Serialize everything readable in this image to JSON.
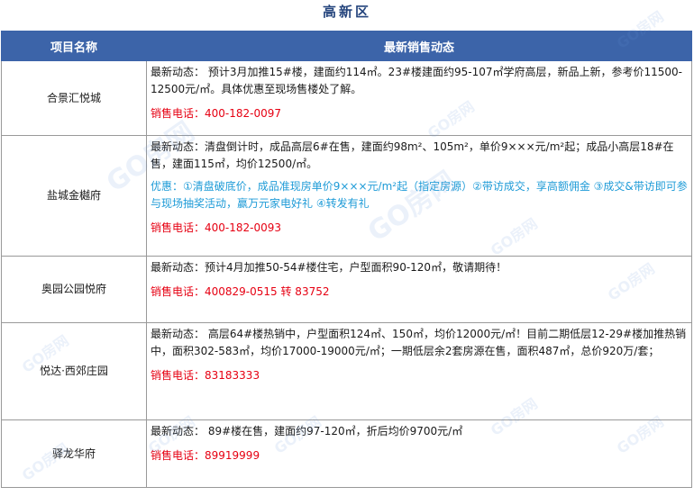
{
  "title": "高新区",
  "headers": {
    "name": "项目名称",
    "news": "最新销售动态"
  },
  "projects": [
    {
      "name": "合景汇悦城",
      "news": "最新动态： 预计3月加推15#楼，建面约114㎡。23#楼建面约95-107㎡学府高层，新品上新，参考价11500-12500元/㎡。具体优惠至现场售楼处了解。",
      "promo": "",
      "phone": "销售电话：400-182-0097"
    },
    {
      "name": "盐城金樾府",
      "news": "最新动态：清盘倒计时，成品高层6#在售，建面约98m²、105m²，单价9×××元/m²起；成品小高层18#在售，建面115㎡，均价12500/㎡。",
      "promo": "优惠：①清盘破底价，成品准现房单价9×××元/m²起（指定房源）②带访成交，享高额佣金 ③成交&带访即可参与现场抽奖活动，赢万元家电好礼 ④转发有礼",
      "phone": "销售电话：400-182-0093"
    },
    {
      "name": "奥园公园悦府",
      "news": "最新动态：预计4月加推50-54#楼住宅，户型面积90-120㎡，敬请期待！",
      "promo": "",
      "phone": "销售电话：400829-0515 转 83752"
    },
    {
      "name": "悦达·西郊庄园",
      "news": "最新动态： 高层64#楼热销中，户型面积124㎡、150㎡，均价12000元/㎡！目前二期低层12-29#楼加推热销中，面积302-583㎡，均价17000-19000元/㎡；一期低层余2套房源在售，面积487㎡，总价920万/套；",
      "promo": "",
      "phone": "销售电话：83183333"
    },
    {
      "name": "驿龙华府",
      "news": "最新动态： 89#楼在售，建面约97-120㎡，折后均价9700元/㎡",
      "promo": "",
      "phone": "销售电话：89919999"
    }
  ],
  "watermark": "GO房网",
  "colors": {
    "header_bg": "#3c64a9",
    "title": "#25457d",
    "phone": "#e60012",
    "promo": "#1e9bd7"
  }
}
